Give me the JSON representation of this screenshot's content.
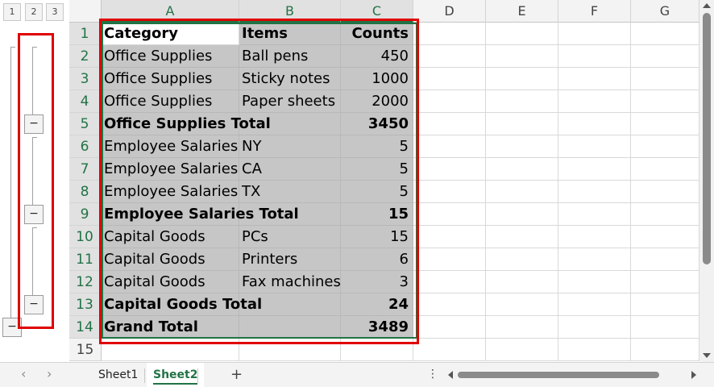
{
  "outline": {
    "level_buttons": [
      "1",
      "2",
      "3"
    ],
    "collapse_symbol": "−"
  },
  "columns": [
    "A",
    "B",
    "C",
    "D",
    "E",
    "F",
    "G"
  ],
  "rows": [
    {
      "n": "1",
      "a": "Category",
      "b": "Items",
      "c": "Counts",
      "bold": true
    },
    {
      "n": "2",
      "a": "Office Supplies",
      "b": "Ball pens",
      "c": "450"
    },
    {
      "n": "3",
      "a": "Office Supplies",
      "b": "Sticky notes",
      "c": "1000"
    },
    {
      "n": "4",
      "a": "Office Supplies",
      "b": "Paper sheets",
      "c": "2000"
    },
    {
      "n": "5",
      "a": "Office Supplies Total",
      "b": "",
      "c": "3450",
      "bold": true
    },
    {
      "n": "6",
      "a": "Employee Salaries",
      "b": "NY",
      "c": "5"
    },
    {
      "n": "7",
      "a": "Employee Salaries",
      "b": "CA",
      "c": "5"
    },
    {
      "n": "8",
      "a": "Employee Salaries",
      "b": "TX",
      "c": "5"
    },
    {
      "n": "9",
      "a": "Employee Salaries Total",
      "b": "",
      "c": "15",
      "bold": true
    },
    {
      "n": "10",
      "a": "Capital Goods",
      "b": "PCs",
      "c": "15"
    },
    {
      "n": "11",
      "a": "Capital Goods",
      "b": "Printers",
      "c": "6"
    },
    {
      "n": "12",
      "a": "Capital Goods",
      "b": "Fax machines",
      "c": "3"
    },
    {
      "n": "13",
      "a": "Capital Goods Total",
      "b": "",
      "c": "24",
      "bold": true
    },
    {
      "n": "14",
      "a": "Grand Total",
      "b": "",
      "c": "3489",
      "bold": true
    },
    {
      "n": "15",
      "a": "",
      "b": "",
      "c": ""
    }
  ],
  "sheets": {
    "tabs": [
      "Sheet1",
      "Sheet2"
    ],
    "active": "Sheet2",
    "add_symbol": "+",
    "more_symbol": "⋮",
    "prev_symbol": "‹",
    "next_symbol": "›"
  },
  "colors": {
    "accent": "#217346",
    "highlight_box": "#e00000",
    "selection_fill": "#c6c6c6"
  }
}
